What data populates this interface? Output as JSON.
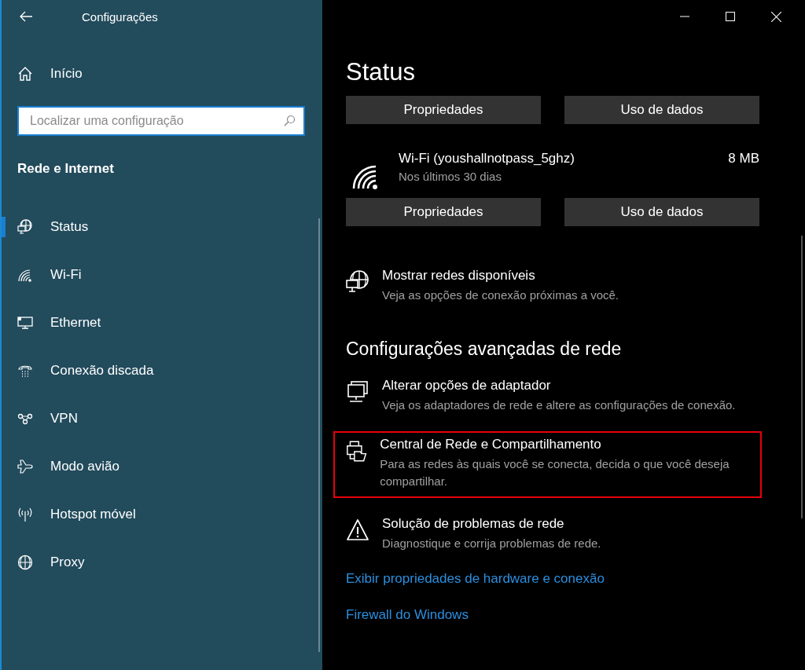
{
  "window": {
    "title": "Configurações"
  },
  "sidebar": {
    "home": "Início",
    "search": {
      "placeholder": "Localizar uma configuração"
    },
    "section": "Rede e Internet",
    "items": [
      {
        "label": "Status",
        "selected": true
      },
      {
        "label": "Wi-Fi",
        "selected": false
      },
      {
        "label": "Ethernet",
        "selected": false
      },
      {
        "label": "Conexão discada",
        "selected": false
      },
      {
        "label": "VPN",
        "selected": false
      },
      {
        "label": "Modo avião",
        "selected": false
      },
      {
        "label": "Hotspot móvel",
        "selected": false
      },
      {
        "label": "Proxy",
        "selected": false
      }
    ]
  },
  "main": {
    "title": "Status",
    "top_buttons": [
      "Propriedades",
      "Uso de dados"
    ],
    "network": {
      "name": "Wi-Fi (youshallnotpass_5ghz)",
      "period": "Nos últimos 30 dias",
      "usage": "8 MB"
    },
    "network_buttons": [
      "Propriedades",
      "Uso de dados"
    ],
    "show_networks": {
      "title": "Mostrar redes disponíveis",
      "description": "Veja as opções de conexão próximas a você."
    },
    "advanced_heading": "Configurações avançadas de rede",
    "settings": [
      {
        "title": "Alterar opções de adaptador",
        "description": "Veja os adaptadores de rede e altere as configurações de conexão.",
        "highlighted": false
      },
      {
        "title": "Central de Rede e Compartilhamento",
        "description": "Para as redes às quais você se conecta, decida o que você deseja compartilhar.",
        "highlighted": true
      },
      {
        "title": "Solução de problemas de rede",
        "description": "Diagnostique e corrija problemas de rede.",
        "highlighted": false
      }
    ],
    "links": [
      "Exibir propriedades de hardware e conexão",
      "Firewall do Windows"
    ]
  }
}
